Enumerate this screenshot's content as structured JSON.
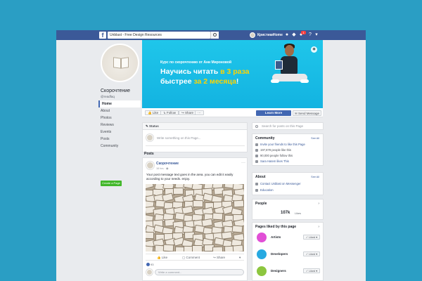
{
  "header": {
    "logo": "f",
    "search_text": "Unblast - Free Design Resources",
    "user_name": "Кристиан",
    "home_label": "Home",
    "notif_count": "1"
  },
  "profile": {
    "name": "Скорочтение",
    "handle": "@readfaq"
  },
  "left_nav": {
    "items": [
      "Home",
      "About",
      "Photos",
      "Reviews",
      "Events",
      "Posts",
      "Community"
    ],
    "create_page": "Create a Page"
  },
  "cover": {
    "subtitle": "Курс по скорочтению от Ани Мироновой",
    "line1_a": "Научись читать ",
    "line1_b": "в 3 раза",
    "line2_a": "быстрее ",
    "line2_b": "за 2 месяца",
    "line2_c": "!"
  },
  "actionbar": {
    "like": "Like",
    "follow": "Follow",
    "share": "Share",
    "more": "···",
    "learn_more": "Learn More",
    "send_message": "Send Message"
  },
  "status": {
    "title": "Status",
    "placeholder": "Write something on this Page..."
  },
  "posts": {
    "label": "Posts",
    "author": "Скорочтение",
    "time": "16 hrs · ",
    "text": "Your post message text goes in the area. you can edit it easily according to your needs. enjoy.",
    "like": "Like",
    "comment": "Comment",
    "share": "Share",
    "reactions": "93",
    "comment_placeholder": "Write a comment..."
  },
  "right": {
    "search_placeholder": "Search for posts on this Page",
    "community": {
      "title": "Community",
      "see_all": "See All",
      "rows": [
        "Invite your friends to like this Page",
        "197,878 people like this",
        "90,000 people follow this",
        "Sara Hatem likes This"
      ]
    },
    "about": {
      "title": "About",
      "see_all": "See All",
      "rows": [
        "Contact Unblast on Messenger",
        "Education"
      ]
    },
    "people": {
      "title": "People",
      "count": "107k",
      "count_label": "Likes"
    },
    "liked": {
      "title": "Pages liked by this page",
      "items": [
        {
          "name": "Artists",
          "button": "✓ Liked ▾",
          "color": "#e14fd6"
        },
        {
          "name": "Developers",
          "button": "✓ Liked ▾",
          "color": "#27a9e1"
        },
        {
          "name": "Designers",
          "button": "✓ Liked ▾",
          "color": "#8dc63f"
        }
      ]
    }
  }
}
